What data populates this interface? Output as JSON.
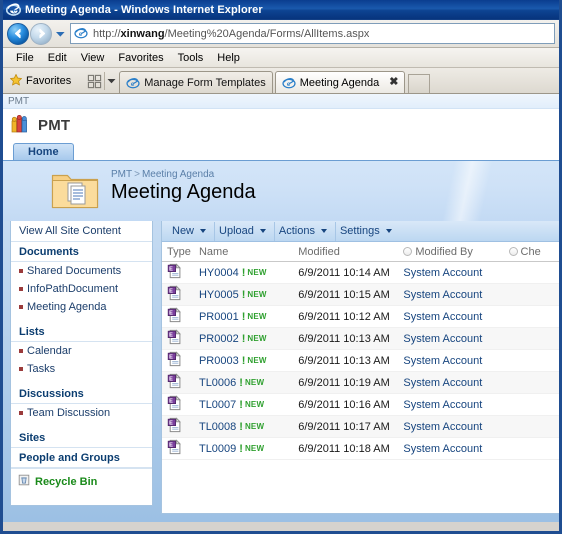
{
  "window": {
    "title": "Meeting Agenda - Windows Internet Explorer",
    "ie_icon": "ie-logo-icon"
  },
  "addressbar": {
    "url_prefix": "http://",
    "url_domain": "xinwang",
    "url_rest": "/Meeting%20Agenda/Forms/AllItems.aspx",
    "back_icon": "back-arrow-icon",
    "forward_icon": "forward-arrow-icon",
    "history_icon": "chevron-down-icon",
    "favicon": "ie-favicon-icon"
  },
  "menubar": {
    "items": [
      {
        "label": "File"
      },
      {
        "label": "Edit"
      },
      {
        "label": "View"
      },
      {
        "label": "Favorites"
      },
      {
        "label": "Tools"
      },
      {
        "label": "Help"
      }
    ]
  },
  "favoritesbar": {
    "favorites_label": "Favorites",
    "star_icon": "star-icon",
    "grid_icon": "favorites-grid-icon",
    "grid_caret_icon": "chevron-down-icon"
  },
  "tabs": {
    "items": [
      {
        "label": "Manage Form Templates",
        "active": false,
        "icon": "ie-tab-icon"
      },
      {
        "label": "Meeting Agenda",
        "active": true,
        "icon": "ie-tab-icon",
        "close_label": "✖"
      }
    ],
    "new_tab_name": "new-tab-button"
  },
  "sharepoint": {
    "top_strip_crumb": "PMT",
    "site_title": "PMT",
    "site_logo_icon": "sharepoint-people-icon",
    "nav_tab": "Home",
    "banner": {
      "folder_icon": "document-library-folder-icon",
      "breadcrumb_root": "PMT",
      "breadcrumb_sep": ">",
      "breadcrumb_current": "Meeting Agenda",
      "title": "Meeting Agenda"
    },
    "quicklaunch": {
      "view_all": "View All Site Content",
      "groups": [
        {
          "header": "Documents",
          "items": [
            {
              "label": "Shared Documents"
            },
            {
              "label": "InfoPathDocument"
            },
            {
              "label": "Meeting Agenda"
            }
          ]
        },
        {
          "header": "Lists",
          "items": [
            {
              "label": "Calendar"
            },
            {
              "label": "Tasks"
            }
          ]
        },
        {
          "header": "Discussions",
          "items": [
            {
              "label": "Team Discussion"
            }
          ]
        },
        {
          "header": "Sites",
          "items": []
        },
        {
          "header": "People and Groups",
          "items": []
        }
      ],
      "recycle_bin": "Recycle Bin",
      "recycle_icon": "recycle-bin-icon"
    },
    "toolbar": {
      "items": [
        {
          "label": "New",
          "caret": true
        },
        {
          "label": "Upload",
          "caret": true
        },
        {
          "label": "Actions",
          "caret": true
        },
        {
          "label": "Settings",
          "caret": true
        }
      ]
    },
    "listview": {
      "columns": [
        {
          "label": "Type",
          "filter": false
        },
        {
          "label": "Name",
          "filter": false
        },
        {
          "label": "Modified",
          "filter": false
        },
        {
          "label": "Modified By",
          "filter": true
        },
        {
          "label": "Che",
          "filter": true
        }
      ],
      "new_badge": "NEW",
      "bang": "!",
      "doc_icon": "infopath-form-icon",
      "rows": [
        {
          "name": "HY0004",
          "modified": "6/9/2011 10:14 AM",
          "modified_by": "System Account",
          "checked_out_to": ""
        },
        {
          "name": "HY0005",
          "modified": "6/9/2011 10:15 AM",
          "modified_by": "System Account",
          "checked_out_to": ""
        },
        {
          "name": "PR0001",
          "modified": "6/9/2011 10:12 AM",
          "modified_by": "System Account",
          "checked_out_to": ""
        },
        {
          "name": "PR0002",
          "modified": "6/9/2011 10:13 AM",
          "modified_by": "System Account",
          "checked_out_to": ""
        },
        {
          "name": "PR0003",
          "modified": "6/9/2011 10:13 AM",
          "modified_by": "System Account",
          "checked_out_to": ""
        },
        {
          "name": "TL0006",
          "modified": "6/9/2011 10:19 AM",
          "modified_by": "System Account",
          "checked_out_to": ""
        },
        {
          "name": "TL0007",
          "modified": "6/9/2011 10:16 AM",
          "modified_by": "System Account",
          "checked_out_to": ""
        },
        {
          "name": "TL0008",
          "modified": "6/9/2011 10:17 AM",
          "modified_by": "System Account",
          "checked_out_to": ""
        },
        {
          "name": "TL0009",
          "modified": "6/9/2011 10:18 AM",
          "modified_by": "System Account",
          "checked_out_to": ""
        }
      ]
    }
  },
  "colors": {
    "title_bar": "#0d4492",
    "window_border": "#1f4d91",
    "sp_accent": "#17457f",
    "sp_banner": "#cfe2f7",
    "link": "#1c3e6b",
    "new_badge": "#2fa02f",
    "recycle_bin": "#1a8a1a"
  }
}
